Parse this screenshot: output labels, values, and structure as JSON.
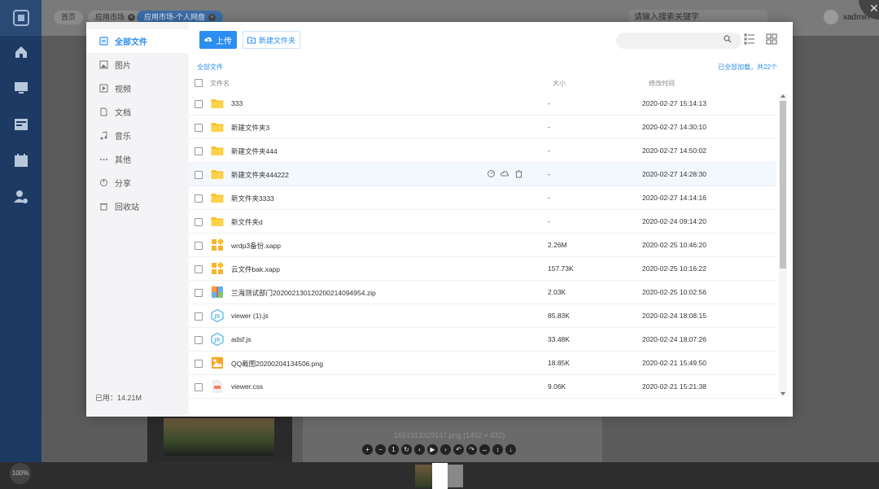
{
  "app": {
    "tabs": [
      {
        "label": "首页",
        "active": false,
        "closable": false
      },
      {
        "label": "应用市场",
        "active": false,
        "closable": true
      },
      {
        "label": "应用市场-个人网盘",
        "active": true,
        "closable": true
      }
    ],
    "search_placeholder": "请输入搜索关键字",
    "user": "xadmin",
    "viewer": {
      "caption": "1651913329147.png (1492 × 832)",
      "zoom": "100%"
    }
  },
  "modal": {
    "sidebar": {
      "items": [
        {
          "label": "全部文件",
          "icon": "all-files-icon",
          "active": true
        },
        {
          "label": "图片",
          "icon": "image-icon",
          "active": false
        },
        {
          "label": "视频",
          "icon": "video-icon",
          "active": false
        },
        {
          "label": "文档",
          "icon": "document-icon",
          "active": false
        },
        {
          "label": "音乐",
          "icon": "music-icon",
          "active": false
        },
        {
          "label": "其他",
          "icon": "more-icon",
          "active": false
        },
        {
          "label": "分享",
          "icon": "share-icon",
          "active": false
        },
        {
          "label": "回收站",
          "icon": "recycle-bin-icon",
          "active": false
        }
      ],
      "used": "已用：14.21M"
    },
    "toolbar": {
      "upload_label": "上传",
      "new_folder_label": "新建文件夹",
      "search_placeholder": ""
    },
    "breadcrumb": "全部文件",
    "loaded_status": "已全部加载，共22个",
    "columns": {
      "name": "文件名",
      "size": "大小",
      "time": "修改时间"
    },
    "files": [
      {
        "name": "333",
        "type": "folder",
        "size": "-",
        "time": "2020-02-27 15:14:13"
      },
      {
        "name": "新建文件夹3",
        "type": "folder",
        "size": "-",
        "time": "2020-02-27 14:30:10"
      },
      {
        "name": "新建文件夹444",
        "type": "folder",
        "size": "-",
        "time": "2020-02-27 14:50:02"
      },
      {
        "name": "新建文件夹444222",
        "type": "folder",
        "size": "-",
        "time": "2020-02-27 14:28:30",
        "hover": true
      },
      {
        "name": "新文件夹3333",
        "type": "folder",
        "size": "-",
        "time": "2020-02-27 14:14:16"
      },
      {
        "name": "新文件夹d",
        "type": "folder",
        "size": "-",
        "time": "2020-02-24 09:14:20"
      },
      {
        "name": "wrdp3备份.xapp",
        "type": "xapp",
        "size": "2.26M",
        "time": "2020-02-25 10:46:20"
      },
      {
        "name": "云文件bak.xapp",
        "type": "xapp",
        "size": "157.73K",
        "time": "2020-02-25 10:16:22"
      },
      {
        "name": "兰海测试部门20200213012020​0214094954.zip",
        "type": "zip",
        "size": "2.03K",
        "time": "2020-02-25 10:02:56"
      },
      {
        "name": "viewer (1).js",
        "type": "js",
        "size": "85.83K",
        "time": "2020-02-24 18:08:15"
      },
      {
        "name": "adsf.js",
        "type": "js",
        "size": "33.48K",
        "time": "2020-02-24 18:07:26"
      },
      {
        "name": "QQ截图20200204134506.png",
        "type": "image",
        "size": "18.85K",
        "time": "2020-02-21 15:49:50"
      },
      {
        "name": "viewer.css",
        "type": "css",
        "size": "9.06K",
        "time": "2020-02-21 15:21:38"
      }
    ],
    "colors": {
      "accent": "#2b8ef0",
      "folder": "#f7c22d"
    }
  }
}
